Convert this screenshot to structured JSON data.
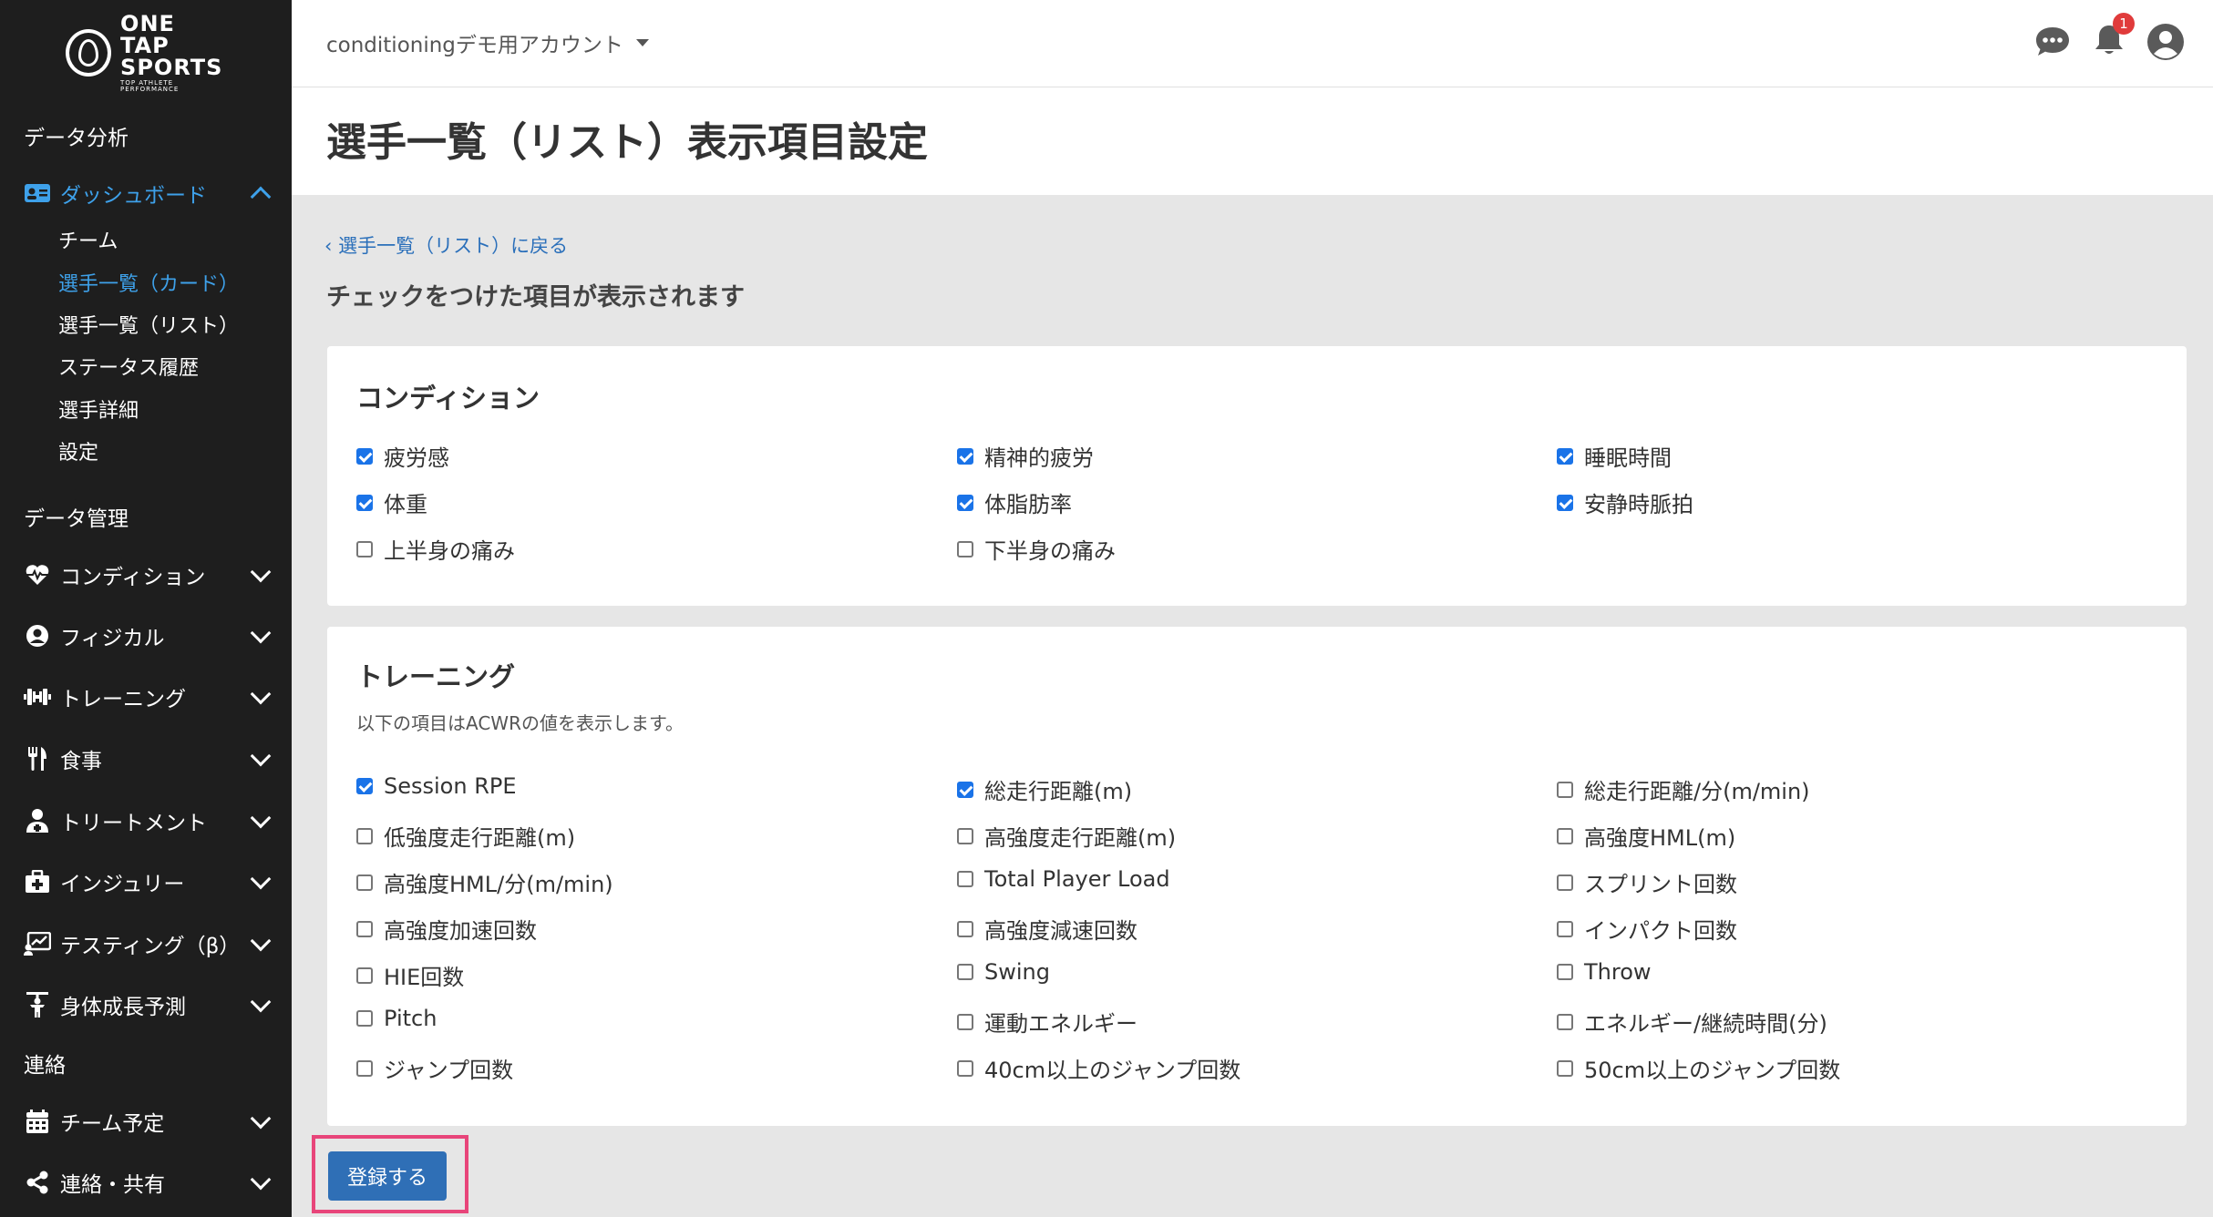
{
  "app": {
    "logo_line1": "ONE TAP",
    "logo_line2": "SPORTS",
    "logo_tagline": "TOP ATHLETE PERFORMANCE"
  },
  "sidebar": {
    "section_analysis": "データ分析",
    "dashboard": {
      "label": "ダッシュボード",
      "icon": "id-card-icon",
      "subitems": [
        "チーム",
        "選手一覧（カード）",
        "選手一覧（リスト）",
        "ステータス履歴",
        "選手詳細",
        "設定"
      ]
    },
    "section_data": "データ管理",
    "items": [
      {
        "label": "コンディション",
        "icon": "heartbeat-icon"
      },
      {
        "label": "フィジカル",
        "icon": "user-circle-icon"
      },
      {
        "label": "トレーニング",
        "icon": "dumbbell-icon"
      },
      {
        "label": "食事",
        "icon": "utensils-icon"
      },
      {
        "label": "トリートメント",
        "icon": "user-medical-icon"
      },
      {
        "label": "インジュリー",
        "icon": "first-aid-icon"
      },
      {
        "label": "テスティング（β）",
        "icon": "chart-board-icon"
      },
      {
        "label": "身体成長予測",
        "icon": "child-growth-icon"
      }
    ],
    "section_contact": "連絡",
    "contact_items": [
      {
        "label": "チーム予定",
        "icon": "calendar-icon"
      },
      {
        "label": "連絡・共有",
        "icon": "share-icon"
      }
    ]
  },
  "topbar": {
    "account": "conditioningデモ用アカウント",
    "notification_count": "1",
    "icons": [
      "chat-icon",
      "bell-icon",
      "user-avatar-icon"
    ]
  },
  "page": {
    "title": "選手一覧（リスト）表示項目設定",
    "back_link": "選手一覧（リスト）に戻る",
    "instruction": "チェックをつけた項目が表示されます",
    "submit": "登録する"
  },
  "condition_card": {
    "title": "コンディション",
    "options": [
      {
        "label": "疲労感",
        "checked": true
      },
      {
        "label": "精神的疲労",
        "checked": true
      },
      {
        "label": "睡眠時間",
        "checked": true
      },
      {
        "label": "体重",
        "checked": true
      },
      {
        "label": "体脂肪率",
        "checked": true
      },
      {
        "label": "安静時脈拍",
        "checked": true
      },
      {
        "label": "上半身の痛み",
        "checked": false
      },
      {
        "label": "下半身の痛み",
        "checked": false
      }
    ]
  },
  "training_card": {
    "title": "トレーニング",
    "note": "以下の項目はACWRの値を表示します。",
    "options": [
      {
        "label": "Session RPE",
        "checked": true
      },
      {
        "label": "総走行距離(m)",
        "checked": true
      },
      {
        "label": "総走行距離/分(m/min)",
        "checked": false
      },
      {
        "label": "低強度走行距離(m)",
        "checked": false
      },
      {
        "label": "高強度走行距離(m)",
        "checked": false
      },
      {
        "label": "高強度HML(m)",
        "checked": false
      },
      {
        "label": "高強度HML/分(m/min)",
        "checked": false
      },
      {
        "label": "Total Player Load",
        "checked": false
      },
      {
        "label": "スプリント回数",
        "checked": false
      },
      {
        "label": "高強度加速回数",
        "checked": false
      },
      {
        "label": "高強度減速回数",
        "checked": false
      },
      {
        "label": "インパクト回数",
        "checked": false
      },
      {
        "label": "HIE回数",
        "checked": false
      },
      {
        "label": "Swing",
        "checked": false
      },
      {
        "label": "Throw",
        "checked": false
      },
      {
        "label": "Pitch",
        "checked": false
      },
      {
        "label": "運動エネルギー",
        "checked": false
      },
      {
        "label": "エネルギー/継続時間(分)",
        "checked": false
      },
      {
        "label": "ジャンプ回数",
        "checked": false
      },
      {
        "label": "40cm以上のジャンプ回数",
        "checked": false
      },
      {
        "label": "50cm以上のジャンプ回数",
        "checked": false
      }
    ]
  }
}
